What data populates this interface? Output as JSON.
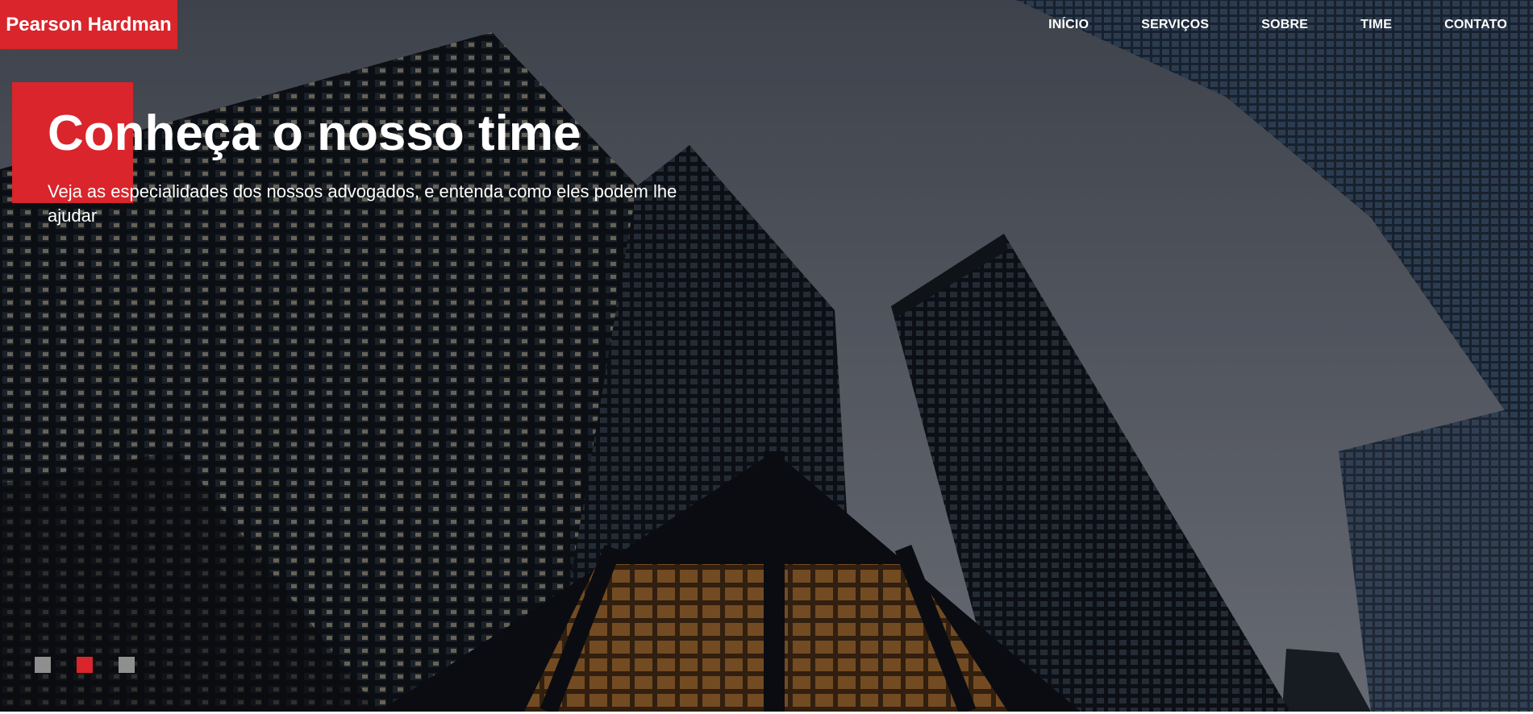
{
  "brand": {
    "name": "Pearson Hardman",
    "accent_color": "#d9252b"
  },
  "nav": {
    "items": [
      {
        "label": "INÍCIO"
      },
      {
        "label": "SERVIÇOS"
      },
      {
        "label": "SOBRE"
      },
      {
        "label": "TIME"
      },
      {
        "label": "CONTATO"
      }
    ]
  },
  "hero": {
    "title": "Conheça o nosso time",
    "subtitle": "Veja as especialidades dos nossos advogados, e entenda como eles podem lhe ajudar",
    "background": "skyscrapers-photo"
  },
  "slider": {
    "slide_count": 3,
    "active_index": 1,
    "inactive_color": "#8f8f8f",
    "active_color": "#d9252b"
  }
}
